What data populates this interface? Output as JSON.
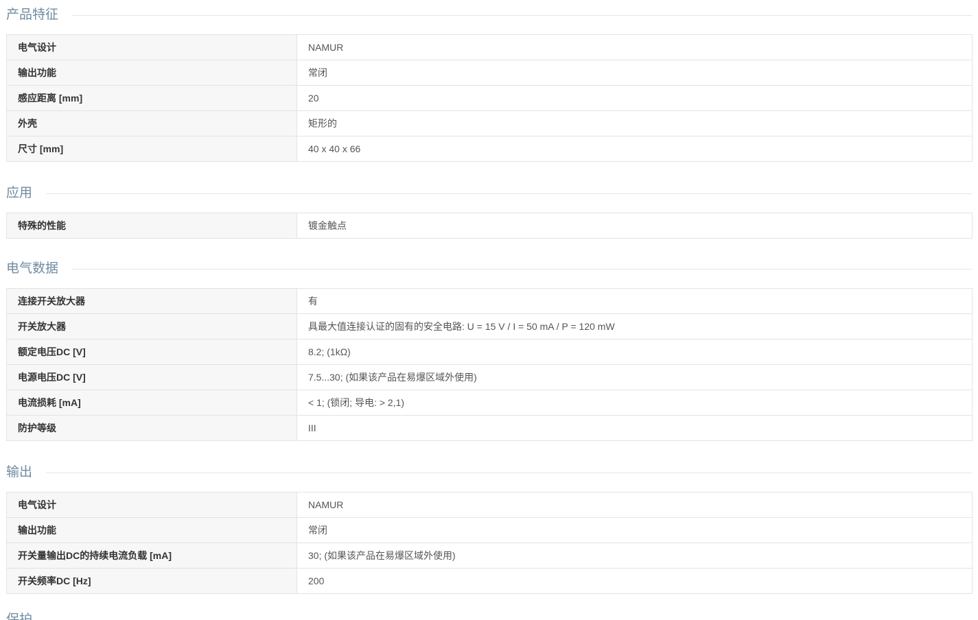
{
  "sections": [
    {
      "title": "产品特征",
      "rows": [
        {
          "key": "电气设计",
          "value": "NAMUR"
        },
        {
          "key": "输出功能",
          "value": "常闭"
        },
        {
          "key": "感应距离 [mm]",
          "value": "20"
        },
        {
          "key": "外壳",
          "value": "矩形的"
        },
        {
          "key": "尺寸 [mm]",
          "value": "40 x 40 x 66"
        }
      ]
    },
    {
      "title": "应用",
      "rows": [
        {
          "key": "特殊的性能",
          "value": "镀金触点"
        }
      ]
    },
    {
      "title": "电气数据",
      "rows": [
        {
          "key": "连接开关放大器",
          "value": "有"
        },
        {
          "key": "开关放大器",
          "value": "具最大值连接认证的固有的安全电路: U = 15 V / I = 50 mA / P = 120 mW"
        },
        {
          "key": "额定电压DC [V]",
          "value": "8.2; (1kΩ)"
        },
        {
          "key": "电源电压DC [V]",
          "value": "7.5...30; (如果该产品在易爆区域外使用)"
        },
        {
          "key": "电流损耗 [mA]",
          "value": "< 1; (锁闭; 导电: > 2,1)"
        },
        {
          "key": "防护等级",
          "value": "III"
        }
      ]
    },
    {
      "title": "输出",
      "rows": [
        {
          "key": "电气设计",
          "value": "NAMUR"
        },
        {
          "key": "输出功能",
          "value": "常闭"
        },
        {
          "key": "开关量输出DC的持续电流负载 [mA]",
          "value": "30; (如果该产品在易爆区域外使用)"
        },
        {
          "key": "开关频率DC [Hz]",
          "value": "200"
        }
      ]
    }
  ],
  "next_section_title": "保护"
}
